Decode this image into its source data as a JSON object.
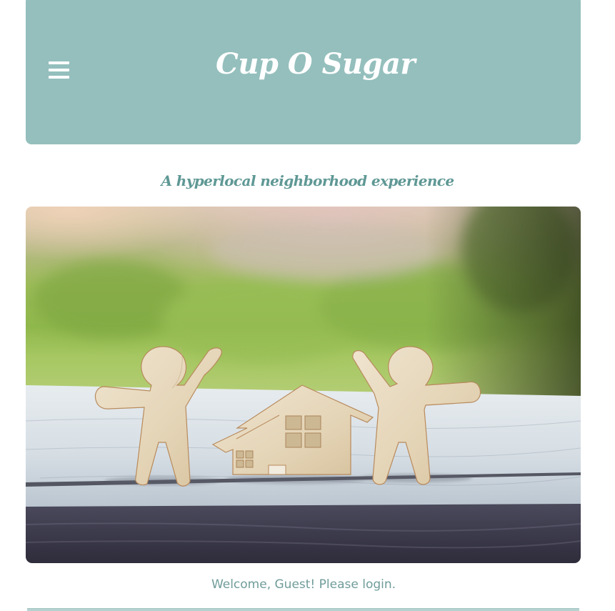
{
  "header": {
    "brand_title": "Cup O Sugar",
    "menu_icon": "hamburger-menu-icon",
    "background_color": "#94bfbd"
  },
  "tagline": "A hyperlocal neighborhood experience",
  "hero": {
    "subject": "wooden-figures-and-house"
  },
  "welcome_message": "Welcome, Guest! Please login.",
  "colors": {
    "accent": "#94bfbd",
    "tagline_text": "#5f9895",
    "welcome_text": "#6f9c9a"
  }
}
